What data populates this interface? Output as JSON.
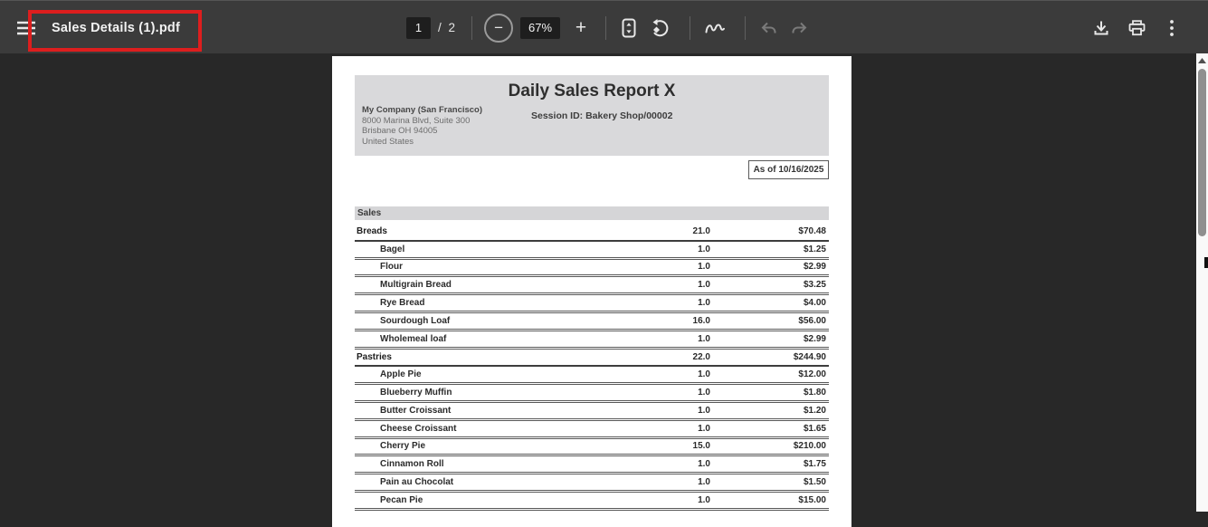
{
  "toolbar": {
    "filename": "Sales Details (1).pdf",
    "page": {
      "current": "1",
      "separator": "/",
      "total": "2"
    },
    "zoom": {
      "minus_label": "−",
      "level": "67%",
      "plus_label": "+"
    }
  },
  "document": {
    "title": "Daily Sales Report X",
    "company": {
      "name": "My Company (San Francisco)",
      "address_line1": "8000 Marina Blvd, Suite 300",
      "address_line2": "Brisbane OH 94005",
      "address_line3": "United States"
    },
    "session_id": "Session ID: Bakery Shop/00002",
    "as_of": "As of 10/16/2025",
    "table": {
      "section_title": "Sales",
      "rows": [
        {
          "name": "Breads",
          "qty": "21.0",
          "amount": "$70.48",
          "category": true
        },
        {
          "name": "Bagel",
          "qty": "1.0",
          "amount": "$1.25",
          "category": false
        },
        {
          "name": "Flour",
          "qty": "1.0",
          "amount": "$2.99",
          "category": false
        },
        {
          "name": "Multigrain Bread",
          "qty": "1.0",
          "amount": "$3.25",
          "category": false
        },
        {
          "name": "Rye Bread",
          "qty": "1.0",
          "amount": "$4.00",
          "category": false
        },
        {
          "name": "Sourdough Loaf",
          "qty": "16.0",
          "amount": "$56.00",
          "category": false
        },
        {
          "name": "Wholemeal loaf",
          "qty": "1.0",
          "amount": "$2.99",
          "category": false
        },
        {
          "name": "Pastries",
          "qty": "22.0",
          "amount": "$244.90",
          "category": true
        },
        {
          "name": "Apple Pie",
          "qty": "1.0",
          "amount": "$12.00",
          "category": false
        },
        {
          "name": "Blueberry Muffin",
          "qty": "1.0",
          "amount": "$1.80",
          "category": false
        },
        {
          "name": "Butter Croissant",
          "qty": "1.0",
          "amount": "$1.20",
          "category": false
        },
        {
          "name": "Cheese Croissant",
          "qty": "1.0",
          "amount": "$1.65",
          "category": false
        },
        {
          "name": "Cherry Pie",
          "qty": "15.0",
          "amount": "$210.00",
          "category": false
        },
        {
          "name": "Cinnamon Roll",
          "qty": "1.0",
          "amount": "$1.75",
          "category": false
        },
        {
          "name": "Pain au Chocolat",
          "qty": "1.0",
          "amount": "$1.50",
          "category": false
        },
        {
          "name": "Pecan Pie",
          "qty": "1.0",
          "amount": "$15.00",
          "category": false
        }
      ]
    }
  },
  "colors": {
    "annotation_red": "#dd1e1e",
    "toolbar_bg": "#3b3b3b",
    "viewer_bg": "#282828",
    "page_bg": "#ffffff",
    "header_box_bg": "#d9d9db",
    "sales_bar_bg": "#d5d5d7"
  }
}
